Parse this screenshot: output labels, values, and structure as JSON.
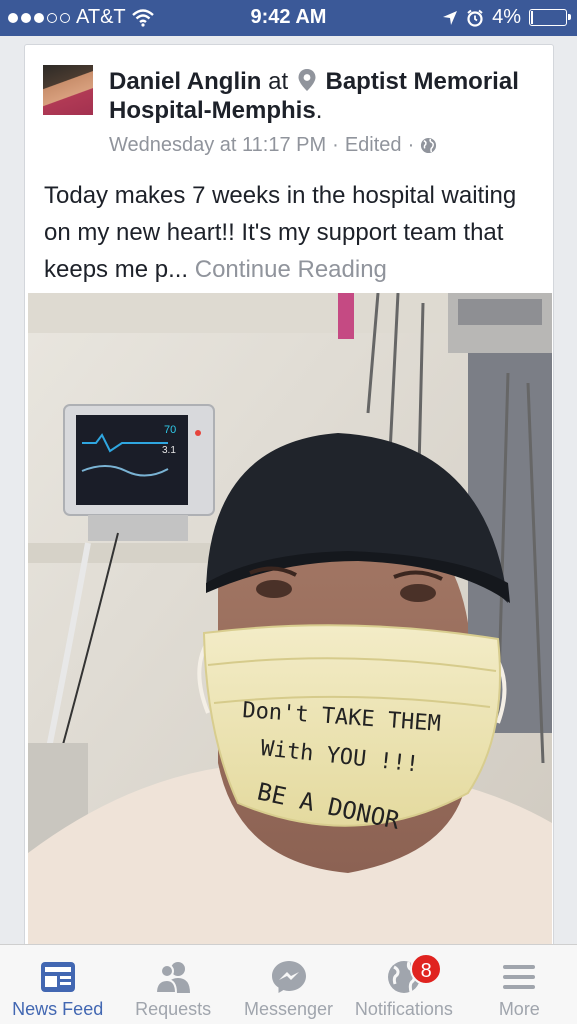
{
  "status_bar": {
    "carrier": "AT&T",
    "time": "9:42 AM",
    "battery_percent": "4%",
    "battery_level": 0.04,
    "signal_bars_filled": 3,
    "signal_bars_total": 5
  },
  "post": {
    "author": "Daniel Anglin",
    "at_word": "at",
    "location": "Baptist Memorial Hospital-Memphis",
    "location_suffix": ".",
    "timestamp": "Wednesday at 11:17 PM",
    "edited": "Edited",
    "separator": "·",
    "text": "Today makes 7 weeks in the hospital waiting on my new heart!! It's my support team that keeps me p...",
    "continue_label": "Continue Reading",
    "photo": {
      "monitor_reading_top": "70",
      "monitor_reading_mid": "3.1",
      "mask_line_1": "Don't TAKE THEM",
      "mask_line_2": "With YOU !!!",
      "mask_line_3": "BE A DONOR"
    }
  },
  "tabs": [
    {
      "label": "News Feed",
      "icon": "news-feed-icon",
      "active": true
    },
    {
      "label": "Requests",
      "icon": "friend-requests-icon",
      "active": false
    },
    {
      "label": "Messenger",
      "icon": "messenger-icon",
      "active": false
    },
    {
      "label": "Notifications",
      "icon": "globe-notifications-icon",
      "active": false,
      "badge": "8"
    },
    {
      "label": "More",
      "icon": "hamburger-menu-icon",
      "active": false
    }
  ],
  "colors": {
    "brand_blue": "#3b5998",
    "tab_active": "#4267b2",
    "badge_red": "#e0231f"
  }
}
